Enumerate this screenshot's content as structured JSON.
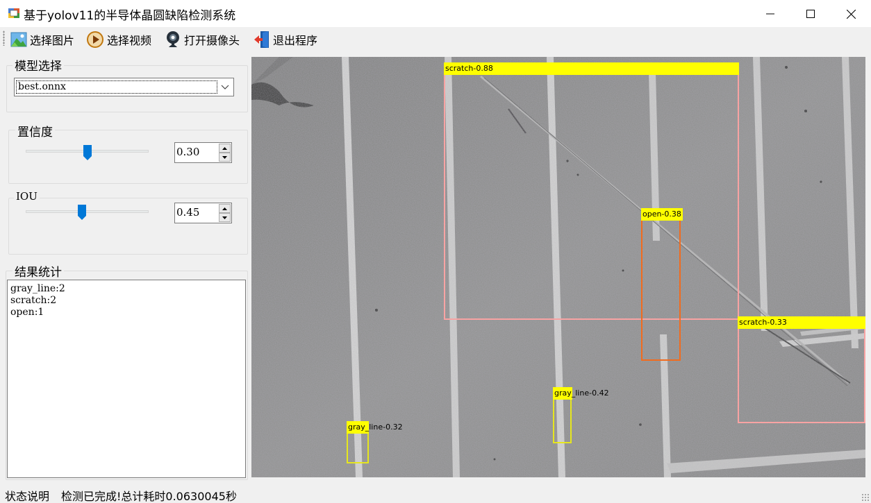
{
  "window": {
    "title": "基于yolov11的半导体晶圆缺陷检测系统",
    "icons": [
      "app-icon",
      "minimize-icon",
      "maximize-icon",
      "close-icon"
    ]
  },
  "toolbar": {
    "items": [
      {
        "label": "选择图片",
        "icon": "image-icon"
      },
      {
        "label": "选择视频",
        "icon": "play-icon"
      },
      {
        "label": "打开摄像头",
        "icon": "webcam-icon"
      },
      {
        "label": "退出程序",
        "icon": "exit-door-icon"
      }
    ]
  },
  "model_group": {
    "title": "模型选择",
    "selected": "best.onnx"
  },
  "confidence_group": {
    "title": "置信度",
    "value": "0.30",
    "slider_fraction": 0.5
  },
  "iou_group": {
    "title": "IOU",
    "value": "0.45",
    "slider_fraction": 0.46
  },
  "results_group": {
    "title": "结果统计",
    "lines": [
      "gray_line:2",
      "scratch:2",
      "open:1"
    ]
  },
  "detections": [
    {
      "label": "scratch-0.88",
      "color": "#f8a3a3",
      "label_bg": "#ffff00"
    },
    {
      "label": "open-0.38",
      "color": "#f26b1d",
      "label_bg": "#ffff00"
    },
    {
      "label": "scratch-0.33",
      "color": "#f8a3a3",
      "label_bg": "#ffff00"
    },
    {
      "label": "gray_line-0.42",
      "color": "#e6e61e",
      "label_bg": "#ffff00"
    },
    {
      "label": "gray_line-0.32",
      "color": "#e6e61e",
      "label_bg": "#ffff00"
    }
  ],
  "status": {
    "label": "状态说明",
    "text": "检测已完成!总计耗时0.0630045秒"
  },
  "colors": {
    "window_bg": "#f0f0f0",
    "slider_thumb": "#0078d7",
    "label_yellow": "#ffff00",
    "scratch_box": "#f8a3a3",
    "open_box": "#f26b1d",
    "gray_line_box": "#e6e61e"
  }
}
